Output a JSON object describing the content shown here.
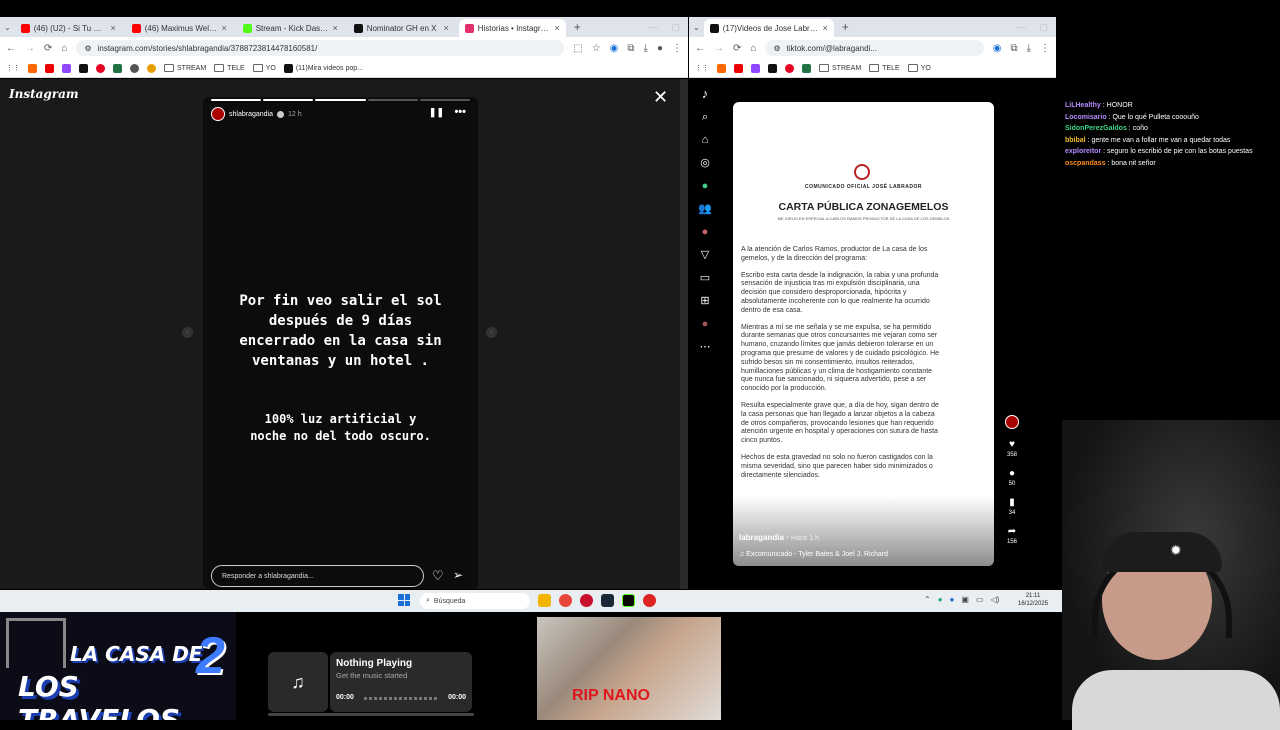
{
  "left_browser": {
    "tabs": [
      {
        "label": "(46) (U2) - Si Tu No Este",
        "color": "#ff0000"
      },
      {
        "label": "(46) Maximus Wel - La Nu",
        "color": "#ff0000"
      },
      {
        "label": "Stream - Kick Dashboard",
        "color": "#53fc18"
      },
      {
        "label": "Nominator GH en X",
        "color": "#111111"
      },
      {
        "label": "Historias • Instagram",
        "color": "#e1306c",
        "active": true
      }
    ],
    "url": "instagram.com/stories/shlabragandia/3788723814478160581/",
    "bookmarks": [
      "STREAM",
      "TELE",
      "YO",
      "(11)Mira videos pop..."
    ]
  },
  "instagram": {
    "logo": "Instagram",
    "username": "shlabragandia",
    "time": "12 h",
    "story_text_1": "Por fin veo salir el sol\ndespués de 9 días\nencerrado en la casa sin\nventanas y un hotel .",
    "story_text_2": "100% luz artificial y\nnoche no del todo oscuro.",
    "reply_placeholder": "Responder a shlabragandia..."
  },
  "right_browser": {
    "tabs": [
      {
        "label": "(17)Videos de Jose Labrador (@",
        "color": "#111111",
        "active": true
      }
    ],
    "url": "tiktok.com/@labragandi...",
    "bookmarks": [
      "STREAM",
      "TELE",
      "YO"
    ]
  },
  "tiktok": {
    "doc_header": "COMUNICADO OFICIAL JOSÉ LABRADOR",
    "doc_title": "CARTA PÚBLICA ZONAGEMELOS",
    "doc_subtitle": "ME DIRIJO EN ESPECIAL A CARLOS RAMOS PRODUCTOR DE LA CASA DE LOS GEMELOS",
    "paragraphs": [
      "A la atención de Carlos Ramos, productor de La casa de los gemelos, y de la dirección del programa:",
      "Escribo esta carta desde la indignación, la rabia y una profunda sensación de injusticia tras mi expulsión disciplinaria, una decisión que considero desproporcionada, hipócrita y absolutamente incoherente con lo que realmente ha ocurrido dentro de esa casa.",
      "Mientras a mí se me señala y se me expulsa, se ha permitido durante semanas que otros concursantes me vejaran como ser humano, cruzando límites que jamás debieron tolerarse en un programa que presume de valores y de cuidado psicológico. He sufrido besos sin mi consentimiento, insultos reiterados, humillaciones públicas y un clima de hostigamiento constante que nunca fue sancionado, ni siquiera advertido, pese a ser conocido por la producción.",
      "Resulta especialmente grave que, a día de hoy, sigan dentro de la casa personas que han llegado a lanzar objetos a la cabeza de otros compañeros, provocando lesiones que han requerido atención urgente en hospital y operaciones con sutura de hasta cinco puntos.",
      "Hechos de esta gravedad no solo no fueron castigados con la misma severidad, sino que parecen haber sido minimizados o directamente silenciados."
    ],
    "author": "labragandia",
    "posted": "Hace 1 h",
    "music": "Excomunicado - Tyler Bates & Joel J. Richard",
    "likes": "358",
    "comments": "50",
    "saves": "34",
    "shares": "156"
  },
  "chat": [
    {
      "user": "LiLHealthy",
      "msg": "HONOR",
      "color": "#b58cff"
    },
    {
      "user": "Locomisario",
      "msg": "Que lo qué Pulleta cooouño",
      "color": "#b58cff"
    },
    {
      "user": "SidonPerezGaldos",
      "msg": "coño",
      "color": "#3fd48a"
    },
    {
      "user": "bbibal",
      "msg": "gente me van a follar me van a quedar todas",
      "color": "#f0c030"
    },
    {
      "user": "exploreitor",
      "msg": "seguro lo escribió de pie con las botas puestas",
      "color": "#b58cff"
    },
    {
      "user": "oscpandass",
      "msg": "bona nit señor",
      "color": "#ff8c1a"
    }
  ],
  "taskbar": {
    "search_placeholder": "Búsqueda",
    "time": "21:11",
    "date": "16/12/2025"
  },
  "overlay": {
    "logo_line1": "LA CASA DE",
    "logo_line2": "LOS TRAVELOS",
    "logo_number": "2",
    "music_title": "Nothing Playing",
    "music_subtitle": "Get the music started",
    "time_start": "00:00",
    "time_end": "00:00",
    "photo_caption": "RIP NANO"
  }
}
